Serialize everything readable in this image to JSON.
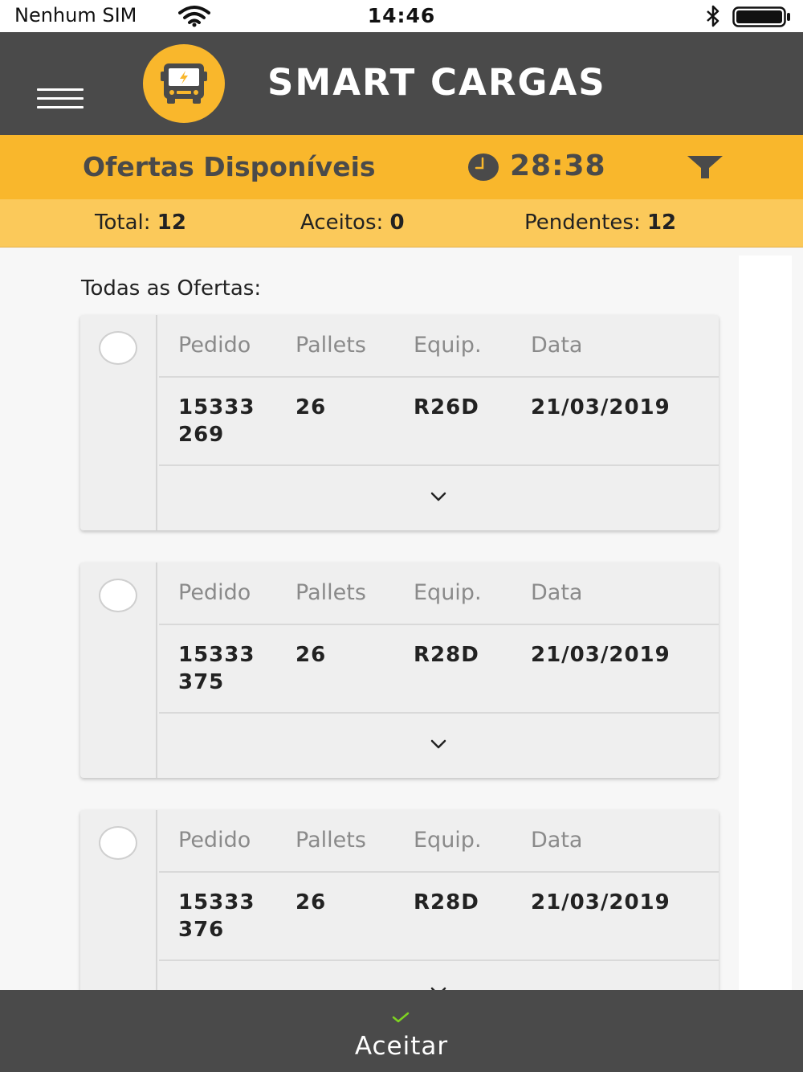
{
  "status_bar": {
    "carrier": "Nenhum SIM",
    "time": "14:46"
  },
  "header": {
    "brand": "SMART CARGAS",
    "menu_icon": "hamburger-menu-icon",
    "logo_icon": "truck-logo-icon"
  },
  "offers_bar": {
    "title": "Ofertas Disponíveis",
    "timer": "28:38",
    "clock_icon": "clock-icon",
    "filter_icon": "filter-icon"
  },
  "counts": {
    "total_label": "Total:",
    "total_value": "12",
    "accepted_label": "Aceitos:",
    "accepted_value": "0",
    "pending_label": "Pendentes:",
    "pending_value": "12"
  },
  "list": {
    "section_label": "Todas as Ofertas:",
    "columns": [
      "Pedido",
      "Pallets",
      "Equip.",
      "Data"
    ],
    "offers": [
      {
        "pedido_line1": "15333",
        "pedido_line2": "269",
        "pallets": "26",
        "equip": "R26D",
        "data": "21/03/2019"
      },
      {
        "pedido_line1": "15333",
        "pedido_line2": "375",
        "pallets": "26",
        "equip": "R28D",
        "data": "21/03/2019"
      },
      {
        "pedido_line1": "15333",
        "pedido_line2": "376",
        "pallets": "26",
        "equip": "R28D",
        "data": "21/03/2019"
      }
    ]
  },
  "bottom_bar": {
    "accept_label": "Aceitar",
    "accept_icon": "checkmark-icon"
  },
  "colors": {
    "header_bg": "#4a4a4a",
    "accent": "#f9b72c",
    "counts_bg": "#fbc95a",
    "check_green": "#7ed321"
  }
}
